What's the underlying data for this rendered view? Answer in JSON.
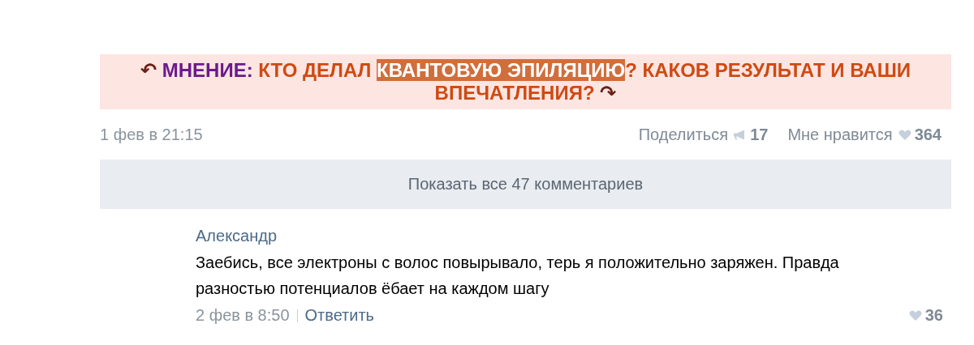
{
  "post": {
    "title": {
      "back_icon": "↶",
      "prefix": "МНЕНИЕ:",
      "forward_icon": "↷",
      "parts": [
        {
          "text": "КТО ДЕЛАЛ ",
          "highlighted": false
        },
        {
          "text": "КВАНТОВУЮ ЭПИЛЯЦИЮ",
          "highlighted": true
        },
        {
          "text": "? КАКОВ РЕЗУЛЬТАТ И ВАШИ ВПЕЧАТЛЕНИЯ?",
          "highlighted": false
        }
      ]
    },
    "date": "1 фев в 21:15",
    "share_label": "Поделиться",
    "share_count": "17",
    "like_label": "Мне нравится",
    "like_count": "364"
  },
  "show_all_comments": "Показать все 47 комментариев",
  "comments": [
    {
      "author": "Александр",
      "text": "Заебись, все электроны с волос повырывало, терь я положительно заряжен. Правда разностью потенциалов ёбает на каждом шагу",
      "date": "2 фев в 8:50",
      "reply": "Ответить",
      "likes": "36"
    }
  ]
}
